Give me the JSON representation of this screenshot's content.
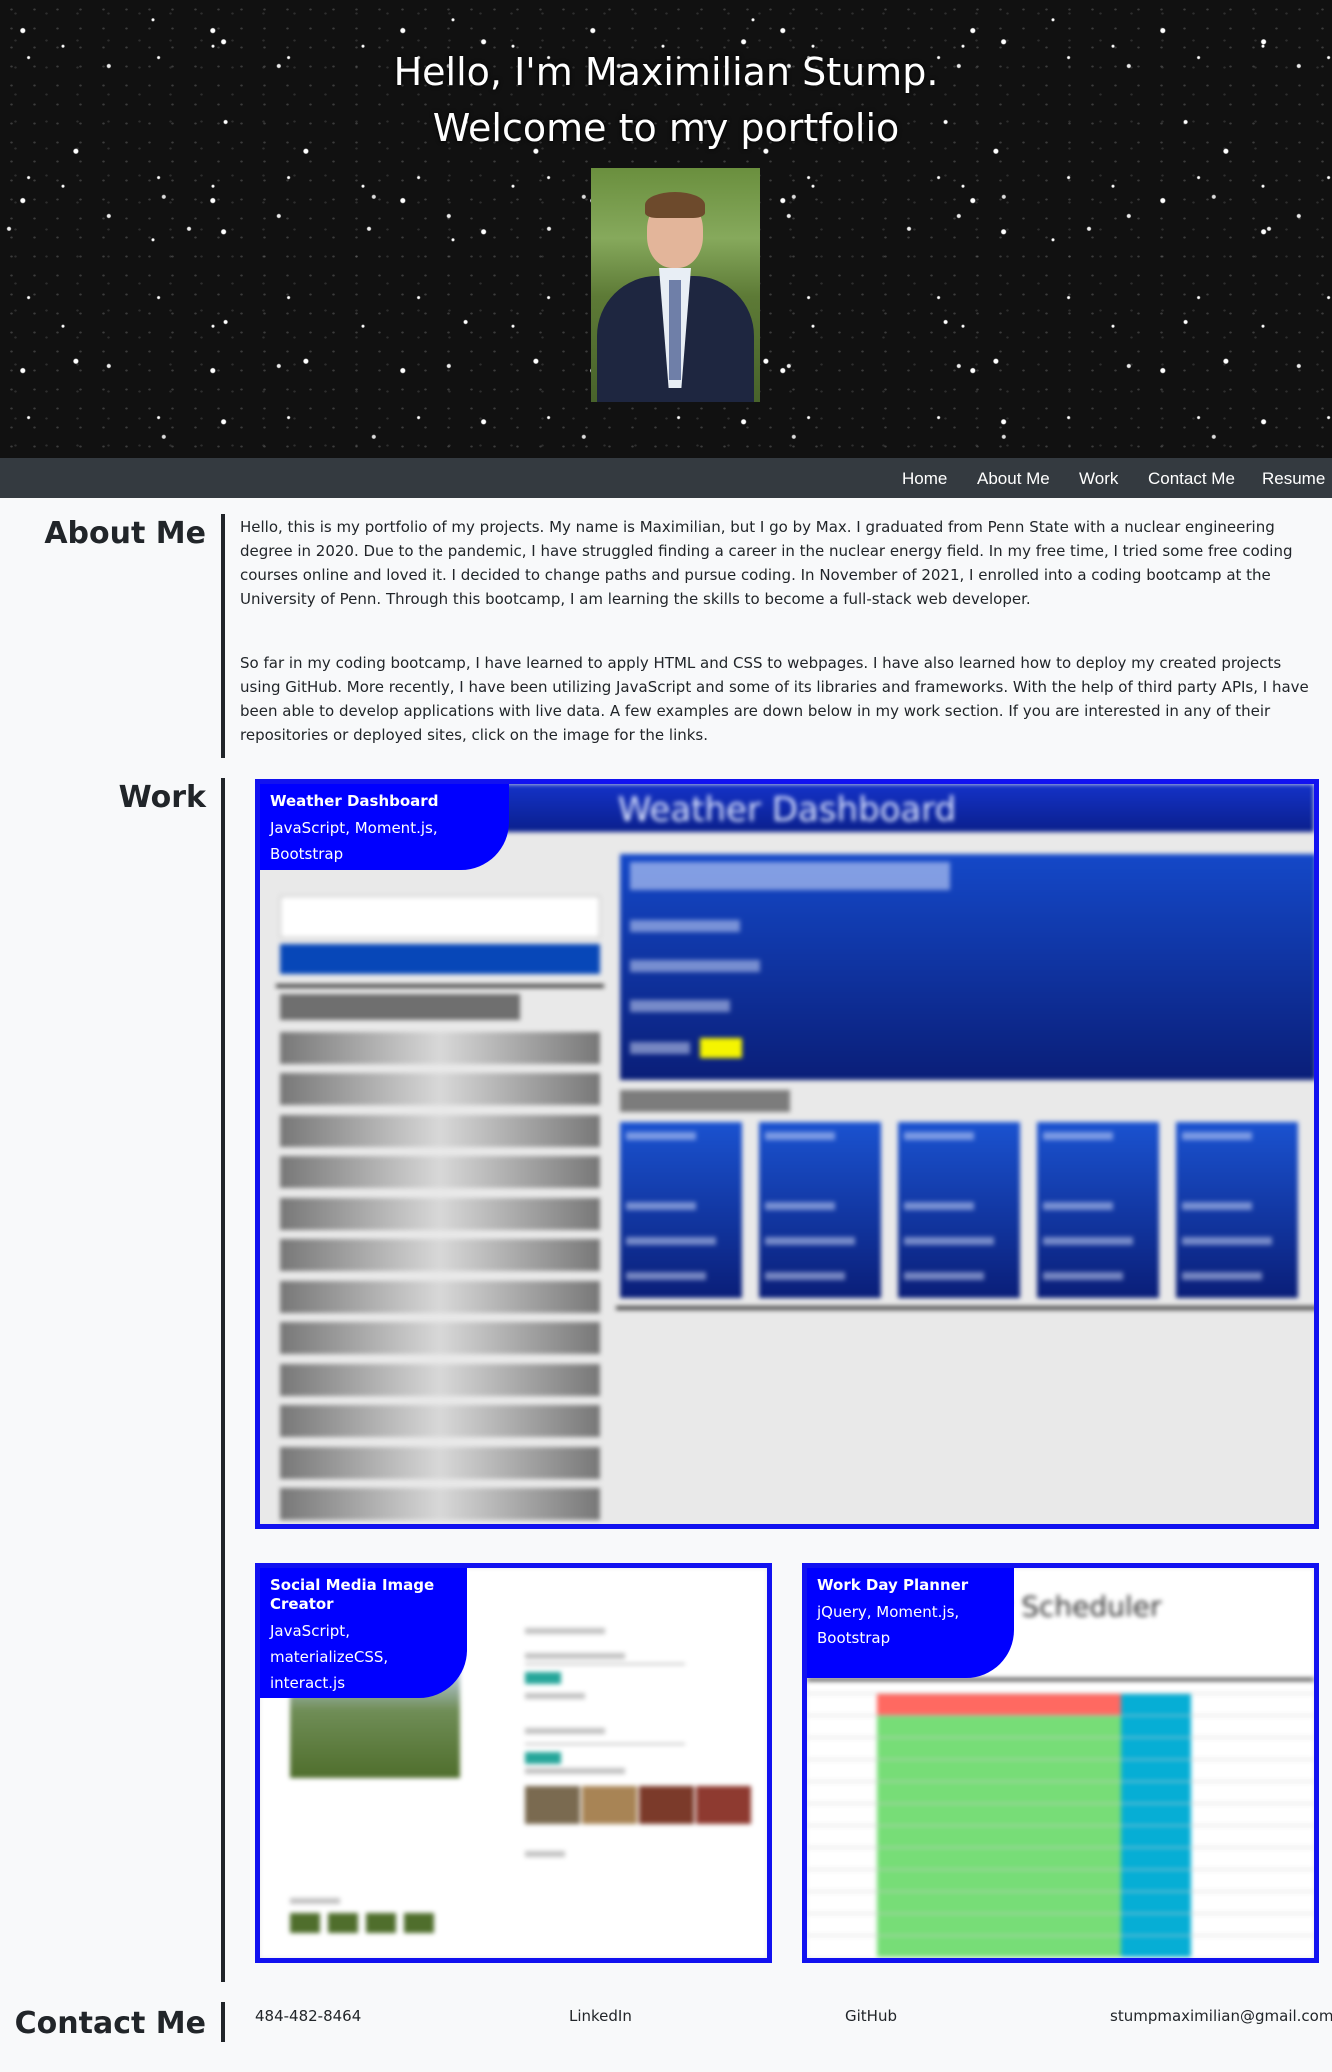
{
  "hero": {
    "line1": "Hello, I'm Maximilian Stump.",
    "line2": "Welcome to my portfolio",
    "portrait_alt": "Photo of Maximilian Stump"
  },
  "nav": {
    "items": [
      {
        "label": "Home"
      },
      {
        "label": "About Me"
      },
      {
        "label": "Work"
      },
      {
        "label": "Contact Me"
      },
      {
        "label": "Resume"
      }
    ]
  },
  "about": {
    "heading": "About Me",
    "paragraph1": "Hello, this is my portfolio of my projects. My name is Maximilian, but I go by Max. I graduated from Penn State with a nuclear engineering degree in 2020. Due to the pandemic, I have struggled finding a career in the nuclear energy field. In my free time, I tried some free coding courses online and loved it. I decided to change paths and pursue coding. In November of 2021, I enrolled into a coding bootcamp at the University of Penn. Through this bootcamp, I am learning the skills to become a full-stack web developer.",
    "paragraph2": "So far in my coding bootcamp, I have learned to apply HTML and CSS to webpages. I have also learned how to deploy my created projects using GitHub. More recently, I have been utilizing JavaScript and some of its libraries and frameworks. With the help of third party APIs, I have been able to develop applications with live data. A few examples are down below in my work section. If you are interested in any of their repositories or deployed sites, click on the image for the links."
  },
  "work": {
    "heading": "Work",
    "projects": [
      {
        "title": "Weather Dashboard",
        "tech": "JavaScript, Moment.js, Bootstrap",
        "screenshot_title": "Weather Dashboard"
      },
      {
        "title": "Social Media Image Creator",
        "tech": "JavaScript, materializeCSS, interact.js"
      },
      {
        "title": "Work Day Planner",
        "tech": "jQuery, Moment.js, Bootstrap",
        "screenshot_title": "Day Scheduler"
      }
    ]
  },
  "contact": {
    "heading": "Contact Me",
    "phone": "484-482-8464",
    "linkedin": "LinkedIn",
    "github": "GitHub",
    "email": "stumpmaximilian@gmail.com"
  },
  "colors": {
    "navbar": "#343a40",
    "card_accent": "#0000ff",
    "page_bg": "#f8f9fa"
  }
}
